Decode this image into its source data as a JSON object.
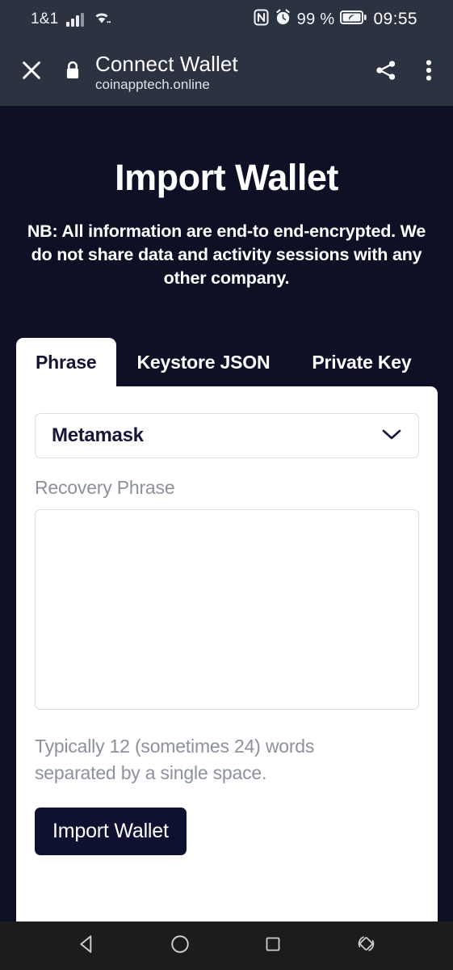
{
  "statusbar": {
    "carrier": "1&1",
    "signal_icon": "signal-bars-icon",
    "wifi_icon": "wifi-icon",
    "nfc_icon": "nfc-icon",
    "alarm_icon": "alarm-clock-icon",
    "battery_percent": "99 %",
    "battery_icon": "battery-eco-icon",
    "time": "09:55"
  },
  "toolbar": {
    "close_icon": "close-icon",
    "lock_icon": "lock-icon",
    "title": "Connect Wallet",
    "url": "coinapptech.online",
    "share_icon": "share-icon",
    "overflow_icon": "more-vertical-icon"
  },
  "page": {
    "title": "Import Wallet",
    "note": "NB: All information are end-to end-encrypted. We do not share data and activity sessions with any other company."
  },
  "tabs": [
    {
      "label": "Phrase",
      "active": true
    },
    {
      "label": "Keystore JSON",
      "active": false
    },
    {
      "label": "Private Key",
      "active": false
    }
  ],
  "form": {
    "wallet_select": {
      "value": "Metamask",
      "chevron_icon": "chevron-down-icon"
    },
    "phrase_label": "Recovery Phrase",
    "phrase_value": "",
    "phrase_placeholder": "",
    "helper": "Typically 12 (sometimes 24) words separated by a single space.",
    "submit_label": "Import Wallet"
  },
  "navbar": {
    "back_icon": "back-triangle-icon",
    "home_icon": "home-circle-icon",
    "recents_icon": "recents-square-icon",
    "rotate_icon": "screen-rotate-icon"
  },
  "colors": {
    "page_background": "#0e1026",
    "toolbar_background": "#2b3240",
    "card_background": "#ffffff",
    "accent_dark": "#0f1130",
    "muted_text": "#8d919c",
    "navbar_background": "#1c1c1c"
  }
}
